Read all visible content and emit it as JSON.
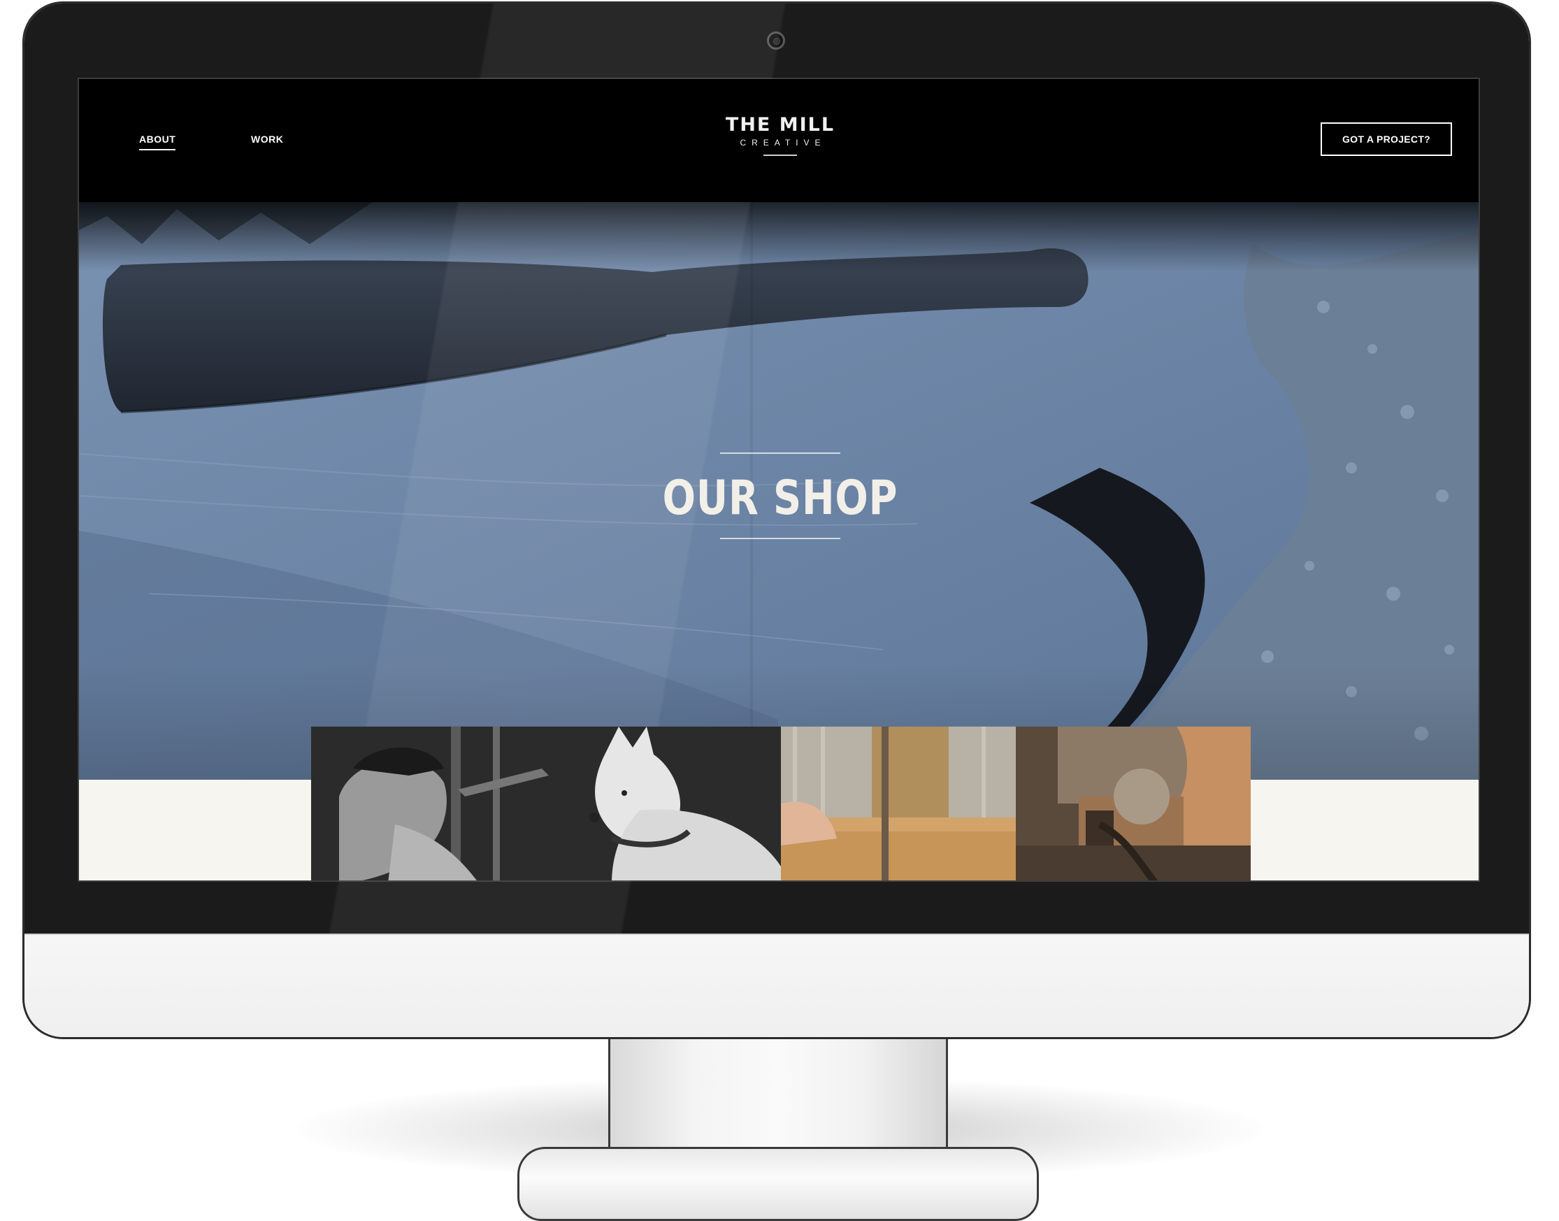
{
  "nav": {
    "about_label": "ABOUT",
    "work_label": "WORK"
  },
  "logo": {
    "title": "THE MILL",
    "subtitle": "CREATIVE"
  },
  "cta": {
    "label": "GOT A PROJECT?"
  },
  "hero": {
    "title": "OUR SHOP"
  },
  "gallery": {
    "tiles": [
      "portrait-and-dog-photo",
      "bandsaw-photo",
      "machine-photo"
    ]
  },
  "colors": {
    "header_bg": "#000000",
    "hero_tint": "#5f7796",
    "strip_bg": "#f7f5f0"
  }
}
